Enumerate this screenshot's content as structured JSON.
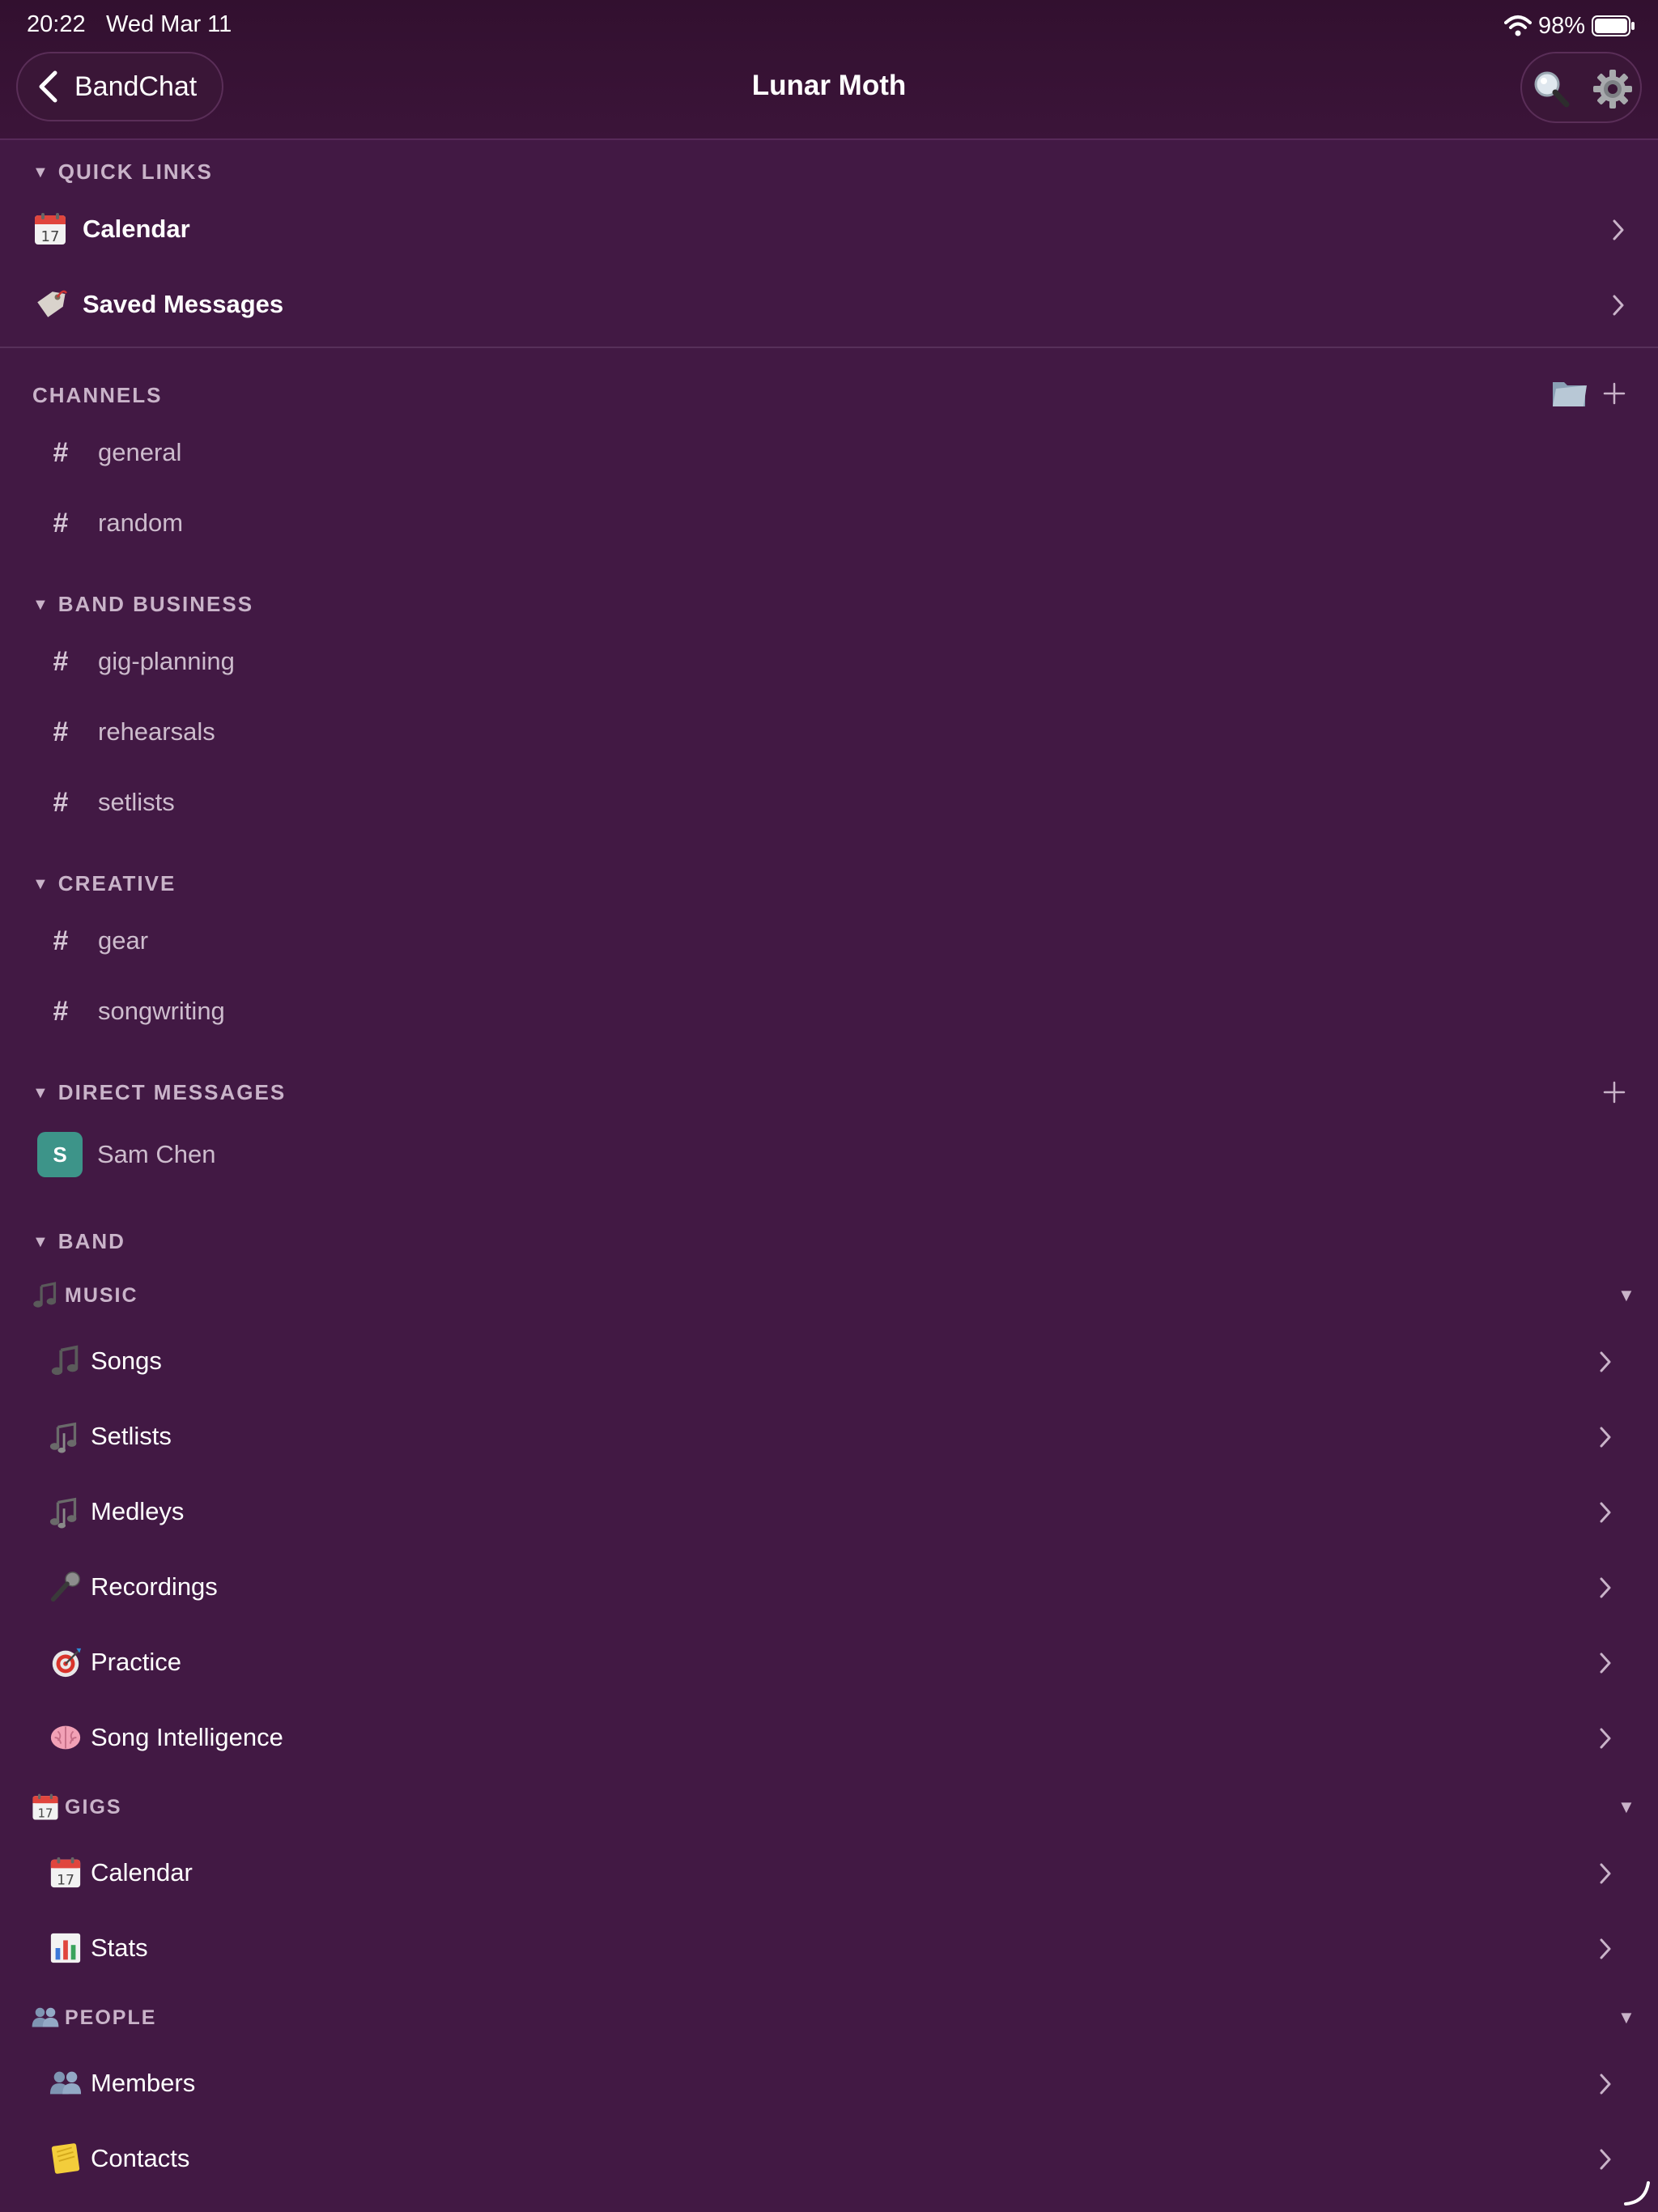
{
  "status_bar": {
    "time": "20:22",
    "date": "Wed Mar 11",
    "battery": "98%"
  },
  "nav": {
    "back_label": "BandChat",
    "title": "Lunar Moth"
  },
  "quick_links": {
    "header": "QUICK LINKS",
    "items": [
      {
        "label": "Calendar",
        "icon": "calendar-icon"
      },
      {
        "label": "Saved Messages",
        "icon": "bookmark-tag-icon"
      }
    ]
  },
  "channels": {
    "header": "CHANNELS",
    "items": [
      "general",
      "random"
    ]
  },
  "band_business": {
    "header": "BAND BUSINESS",
    "items": [
      "gig-planning",
      "rehearsals",
      "setlists"
    ]
  },
  "creative": {
    "header": "CREATIVE",
    "items": [
      "gear",
      "songwriting"
    ]
  },
  "direct_messages": {
    "header": "DIRECT MESSAGES",
    "items": [
      {
        "initial": "S",
        "name": "Sam Chen",
        "avatar_color": "#3d9489"
      }
    ]
  },
  "band": {
    "header": "BAND",
    "groups": [
      {
        "title": "MUSIC",
        "icon": "music-note-icon",
        "items": [
          {
            "label": "Songs",
            "icon": "music-note-icon"
          },
          {
            "label": "Setlists",
            "icon": "music-notes-icon"
          },
          {
            "label": "Medleys",
            "icon": "music-notes-icon"
          },
          {
            "label": "Recordings",
            "icon": "microphone-icon"
          },
          {
            "label": "Practice",
            "icon": "target-icon"
          },
          {
            "label": "Song Intelligence",
            "icon": "brain-icon"
          }
        ]
      },
      {
        "title": "GIGS",
        "icon": "calendar-icon",
        "items": [
          {
            "label": "Calendar",
            "icon": "calendar-icon"
          },
          {
            "label": "Stats",
            "icon": "bar-chart-icon"
          }
        ]
      },
      {
        "title": "PEOPLE",
        "icon": "people-icon",
        "items": [
          {
            "label": "Members",
            "icon": "people-icon"
          },
          {
            "label": "Contacts",
            "icon": "notepad-icon"
          }
        ]
      }
    ]
  },
  "colors": {
    "background": "#421944",
    "topbar": "#32102f",
    "header_text": "#c9b3c9",
    "channel_text": "#cdbccd",
    "avatar": "#3d9489"
  }
}
